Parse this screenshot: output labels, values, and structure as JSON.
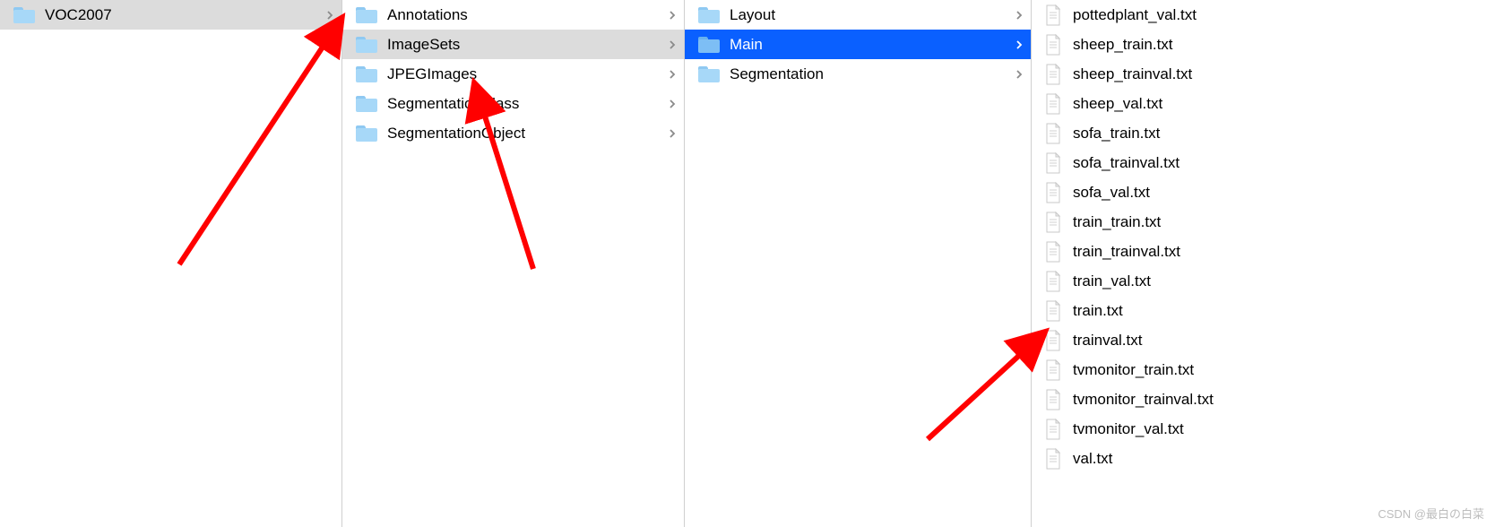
{
  "columns": [
    {
      "id": "col-1",
      "items": [
        {
          "type": "folder",
          "label": "VOC2007",
          "hasChildren": true,
          "state": "selected-inactive"
        }
      ]
    },
    {
      "id": "col-2",
      "items": [
        {
          "type": "folder",
          "label": "Annotations",
          "hasChildren": true,
          "state": ""
        },
        {
          "type": "folder",
          "label": "ImageSets",
          "hasChildren": true,
          "state": "selected-inactive"
        },
        {
          "type": "folder",
          "label": "JPEGImages",
          "hasChildren": true,
          "state": ""
        },
        {
          "type": "folder",
          "label": "SegmentationClass",
          "hasChildren": true,
          "state": ""
        },
        {
          "type": "folder",
          "label": "SegmentationObject",
          "hasChildren": true,
          "state": ""
        }
      ]
    },
    {
      "id": "col-3",
      "items": [
        {
          "type": "folder",
          "label": "Layout",
          "hasChildren": true,
          "state": ""
        },
        {
          "type": "folder",
          "label": "Main",
          "hasChildren": true,
          "state": "selected-active"
        },
        {
          "type": "folder",
          "label": "Segmentation",
          "hasChildren": true,
          "state": ""
        }
      ]
    },
    {
      "id": "col-4",
      "items": [
        {
          "type": "file",
          "label": "pottedplant_val.txt",
          "hasChildren": false,
          "state": ""
        },
        {
          "type": "file",
          "label": "sheep_train.txt",
          "hasChildren": false,
          "state": ""
        },
        {
          "type": "file",
          "label": "sheep_trainval.txt",
          "hasChildren": false,
          "state": ""
        },
        {
          "type": "file",
          "label": "sheep_val.txt",
          "hasChildren": false,
          "state": ""
        },
        {
          "type": "file",
          "label": "sofa_train.txt",
          "hasChildren": false,
          "state": ""
        },
        {
          "type": "file",
          "label": "sofa_trainval.txt",
          "hasChildren": false,
          "state": ""
        },
        {
          "type": "file",
          "label": "sofa_val.txt",
          "hasChildren": false,
          "state": ""
        },
        {
          "type": "file",
          "label": "train_train.txt",
          "hasChildren": false,
          "state": ""
        },
        {
          "type": "file",
          "label": "train_trainval.txt",
          "hasChildren": false,
          "state": ""
        },
        {
          "type": "file",
          "label": "train_val.txt",
          "hasChildren": false,
          "state": ""
        },
        {
          "type": "file",
          "label": "train.txt",
          "hasChildren": false,
          "state": ""
        },
        {
          "type": "file",
          "label": "trainval.txt",
          "hasChildren": false,
          "state": ""
        },
        {
          "type": "file",
          "label": "tvmonitor_train.txt",
          "hasChildren": false,
          "state": ""
        },
        {
          "type": "file",
          "label": "tvmonitor_trainval.txt",
          "hasChildren": false,
          "state": ""
        },
        {
          "type": "file",
          "label": "tvmonitor_val.txt",
          "hasChildren": false,
          "state": ""
        },
        {
          "type": "file",
          "label": "val.txt",
          "hasChildren": false,
          "state": ""
        }
      ]
    }
  ],
  "watermark": "CSDN @最白の白菜"
}
